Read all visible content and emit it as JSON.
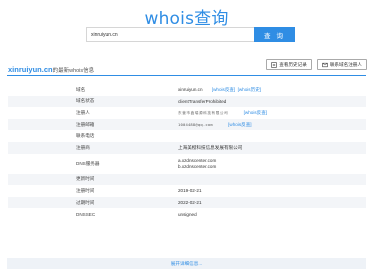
{
  "logo": "whois查询",
  "search": {
    "value": "xinruiyun.cn",
    "button_label": "查 询"
  },
  "result": {
    "domain": "xinruiyun.cn",
    "heading_suffix": "的最新whois信息",
    "actions": {
      "previous_label": "查看历史记录",
      "contact_label": "联系域名注册人"
    }
  },
  "rows": [
    {
      "key": "域名",
      "value": "xinruiyun.cn",
      "links": [
        "[whois反查]",
        "[whois历史]"
      ]
    },
    {
      "key": "域名状态",
      "value": "clientTransferProhibited"
    },
    {
      "key": "注册人",
      "value_image_text": "东营市鑫瑞源科技有限公司",
      "links": [
        "[whois反查]"
      ]
    },
    {
      "key": "注册邮箱",
      "value_image_text": "1004488@qq.com",
      "links": [
        "[whois反查]"
      ]
    },
    {
      "key": "联系电话",
      "value": ""
    },
    {
      "key": "注册商",
      "value": "上海美橙科技信息发展有限公司"
    },
    {
      "key": "DNS服务器",
      "value_lines": [
        "a.xzdnscenter.com",
        "b.xzdnscenter.com"
      ]
    },
    {
      "key": "更新时间",
      "value": ""
    },
    {
      "key": "注册时间",
      "value": "2019-02-21"
    },
    {
      "key": "过期时间",
      "value": "2022-02-21"
    },
    {
      "key": "DNSSEC",
      "value": "unsigned"
    }
  ],
  "more_link": "展开详细信息..."
}
